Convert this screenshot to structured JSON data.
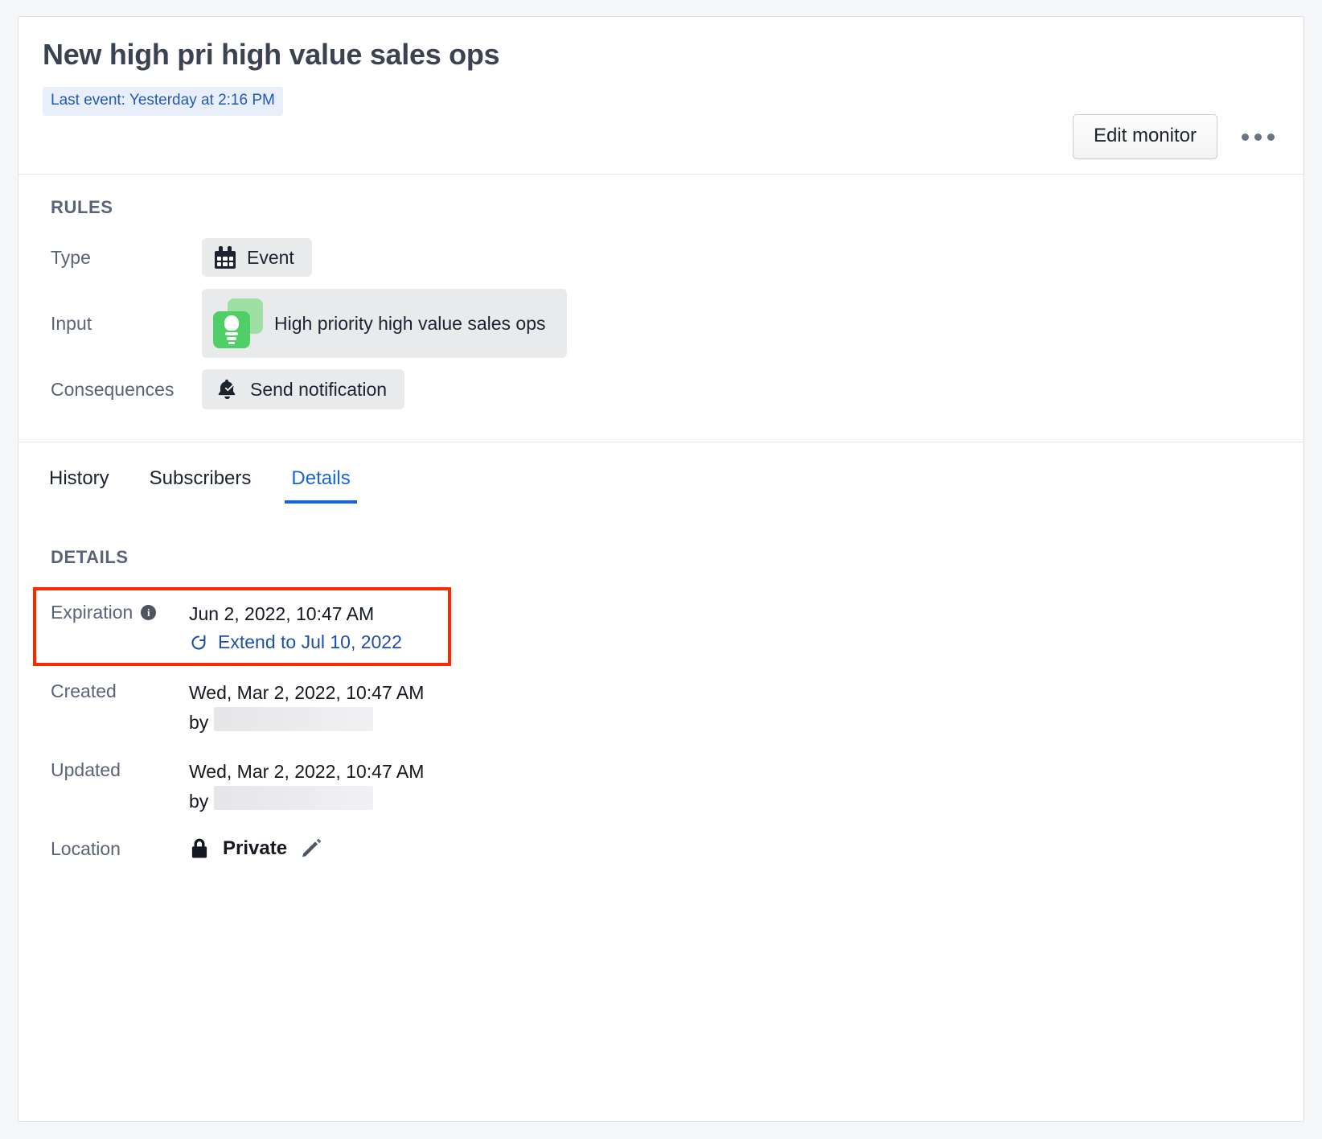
{
  "header": {
    "title": "New high pri high value sales ops",
    "last_event_badge": "Last event: Yesterday at 2:16 PM",
    "edit_button": "Edit monitor",
    "overflow_menu": "overflow-menu"
  },
  "rules": {
    "section_label": "RULES",
    "rows": [
      {
        "key": "Type",
        "value": "Event",
        "icon": "calendar-icon"
      },
      {
        "key": "Input",
        "value": "High priority high value sales ops",
        "icon": "lightbulb-icon"
      },
      {
        "key": "Consequences",
        "value": "Send notification",
        "icon": "bell-check-icon"
      }
    ]
  },
  "tabs": [
    {
      "label": "History",
      "active": false
    },
    {
      "label": "Subscribers",
      "active": false
    },
    {
      "label": "Details",
      "active": true
    }
  ],
  "details": {
    "section_label": "DETAILS",
    "expiration": {
      "key": "Expiration",
      "value": "Jun 2, 2022, 10:47 AM",
      "extend_label": "Extend to Jul 10, 2022",
      "info_glyph": "i"
    },
    "created": {
      "key": "Created",
      "value": "Wed, Mar 2, 2022, 10:47 AM",
      "by_label": "by",
      "by_value": ""
    },
    "updated": {
      "key": "Updated",
      "value": "Wed, Mar 2, 2022, 10:47 AM",
      "by_label": "by",
      "by_value": ""
    },
    "location": {
      "key": "Location",
      "value": "Private"
    }
  },
  "colors": {
    "link": "#1565d8",
    "badge_bg": "#e9eefb",
    "badge_text": "#2159b8",
    "highlight_border": "#fc2a00",
    "chip_bg": "#e9eaec",
    "bulb_green": "#4fd066",
    "heading": "#5a6377"
  }
}
